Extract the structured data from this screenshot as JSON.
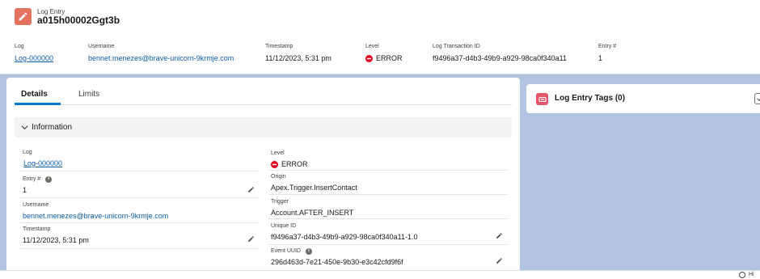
{
  "header": {
    "object_type": "Log Entry",
    "record_name": "a015h00002Ggt3b",
    "icon": "pencil-icon",
    "highlights": {
      "log": {
        "label": "Log",
        "value": "Log-000000"
      },
      "username": {
        "label": "Username",
        "value": "bennet.menezes@brave-unicorn-9krmje.com"
      },
      "timestamp": {
        "label": "Timestamp",
        "value": "11/12/2023, 5:31 pm"
      },
      "level": {
        "label": "Level",
        "value": "ERROR"
      },
      "transaction": {
        "label": "Log Transaction ID",
        "value": "f9496a37-d4b3-49b9-a929-98ca0f340a11"
      },
      "entry": {
        "label": "Entry #",
        "value": "1"
      }
    }
  },
  "tabs": {
    "details": "Details",
    "limits": "Limits"
  },
  "section": {
    "title": "Information"
  },
  "fields": {
    "log": {
      "label": "Log",
      "value": "Log-000000"
    },
    "entry": {
      "label": "Entry #",
      "value": "1"
    },
    "username": {
      "label": "Username",
      "value": "bennet.menezes@brave-unicorn-9krmje.com"
    },
    "timestamp": {
      "label": "Timestamp",
      "value": "11/12/2023, 5:31 pm"
    },
    "level": {
      "label": "Level",
      "value": "ERROR"
    },
    "origin": {
      "label": "Origin",
      "value": "Apex.Trigger.InsertContact"
    },
    "trigger": {
      "label": "Trigger",
      "value": "Account.AFTER_INSERT"
    },
    "unique_id": {
      "label": "Unique ID",
      "value": "f9496a37-d4b3-49b9-a929-98ca0f340a11-1.0"
    },
    "event_uuid": {
      "label": "Event UUID",
      "value": "296d463d-7e21-450e-9b30-e3c42cfd9f6f"
    }
  },
  "related": {
    "tags_title": "Log Entry Tags (0)"
  },
  "footer": {
    "text": "Hi"
  },
  "colors": {
    "accent": "#0176d3",
    "link": "#0b5cab",
    "header_icon": "#e3735e",
    "tag_icon": "#e3566b",
    "error": "#ea001e",
    "background": "#b0c4df"
  }
}
